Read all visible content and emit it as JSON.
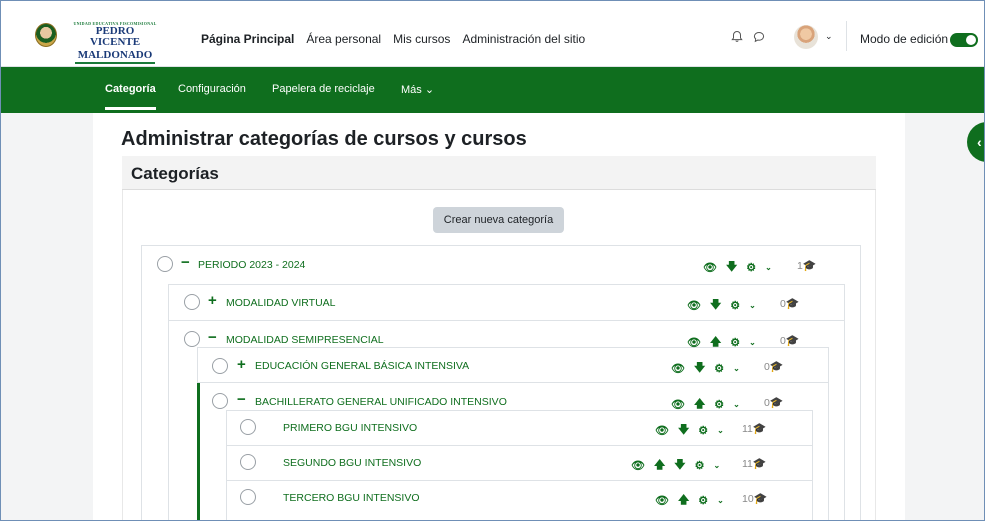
{
  "brand": {
    "tagline": "UNIDAD EDUCATIVA FISCOMISIONAL",
    "line1": "PEDRO VICENTE",
    "line2": "MALDONADO"
  },
  "nav": {
    "items": [
      "Página Principal",
      "Área personal",
      "Mis cursos",
      "Administración del sitio"
    ],
    "edit_mode_label": "Modo de edición",
    "edit_mode_on": true
  },
  "secondary_nav": {
    "items": [
      "Categoría",
      "Configuración",
      "Papelera de reciclaje",
      "Más ⌄"
    ]
  },
  "page": {
    "title": "Administrar categorías de cursos y cursos",
    "card_title": "Categorías",
    "create_button": "Crear nueva categoría"
  },
  "categories": [
    {
      "name": "PERIODO 2023 - 2024",
      "toggle": "−",
      "actions": [
        "👁",
        "🡇",
        "⚙"
      ],
      "count": "1"
    },
    {
      "name": "MODALIDAD VIRTUAL",
      "toggle": "+",
      "actions": [
        "👁",
        "🡇",
        "⚙"
      ],
      "count": "0"
    },
    {
      "name": "MODALIDAD SEMIPRESENCIAL",
      "toggle": "−",
      "actions": [
        "👁",
        "🡅",
        "⚙"
      ],
      "count": "0"
    },
    {
      "name": "EDUCACIÓN GENERAL BÁSICA INTENSIVA",
      "toggle": "+",
      "actions": [
        "👁",
        "🡇",
        "⚙"
      ],
      "count": "0"
    },
    {
      "name": "BACHILLERATO GENERAL UNIFICADO INTENSIVO",
      "toggle": "−",
      "actions": [
        "👁",
        "🡅",
        "⚙"
      ],
      "count": "0"
    },
    {
      "name": "PRIMERO BGU INTENSIVO",
      "toggle": "",
      "actions": [
        "👁",
        "🡇",
        "⚙"
      ],
      "count": "11"
    },
    {
      "name": "SEGUNDO BGU INTENSIVO",
      "toggle": "",
      "actions": [
        "👁",
        "🡅",
        "🡇",
        "⚙"
      ],
      "count": "11"
    },
    {
      "name": "TERCERO BGU INTENSIVO",
      "toggle": "",
      "actions": [
        "👁",
        "🡅",
        "⚙"
      ],
      "count": "10"
    }
  ],
  "colors": {
    "brand_green": "#0f6e1e",
    "button_gray": "#ced4da"
  }
}
